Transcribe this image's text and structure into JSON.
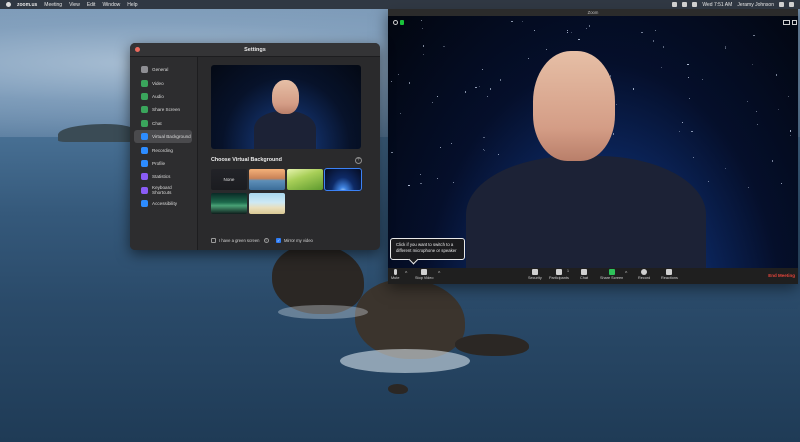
{
  "menubar": {
    "app_name": "zoom.us",
    "menus": [
      "Meeting",
      "View",
      "Edit",
      "Window",
      "Help"
    ],
    "clock": "Wed 7:51 AM",
    "user": "Jeramy Johnson"
  },
  "settings": {
    "title": "Settings",
    "sidebar": [
      {
        "label": "General",
        "icon": "gear-icon",
        "color": "#8e8e93"
      },
      {
        "label": "Video",
        "icon": "video-camera-icon",
        "color": "#3aa55c"
      },
      {
        "label": "Audio",
        "icon": "headphones-icon",
        "color": "#3aa55c"
      },
      {
        "label": "Share Screen",
        "icon": "share-screen-icon",
        "color": "#3aa55c"
      },
      {
        "label": "Chat",
        "icon": "chat-icon",
        "color": "#3aa55c"
      },
      {
        "label": "Virtual Background",
        "icon": "virtual-background-icon",
        "color": "#2d8cff",
        "active": true
      },
      {
        "label": "Recording",
        "icon": "recording-icon",
        "color": "#2d8cff"
      },
      {
        "label": "Profile",
        "icon": "profile-icon",
        "color": "#2d8cff"
      },
      {
        "label": "Statistics",
        "icon": "statistics-icon",
        "color": "#8a5cf6"
      },
      {
        "label": "Keyboard Shortcuts",
        "icon": "keyboard-icon",
        "color": "#8a5cf6"
      },
      {
        "label": "Accessibility",
        "icon": "accessibility-icon",
        "color": "#2d8cff"
      }
    ],
    "choose_label": "Choose Virtual Background",
    "add_symbol": "+",
    "backgrounds": [
      {
        "label": "None"
      },
      {
        "label": ""
      },
      {
        "label": ""
      },
      {
        "label": "",
        "selected": true
      },
      {
        "label": ""
      },
      {
        "label": ""
      }
    ],
    "green_screen_label": "I have a green screen",
    "mirror_label": "Mirror my video",
    "green_screen_checked": false,
    "mirror_checked": true
  },
  "zoom": {
    "title": "Zoom",
    "toolbar": [
      {
        "label": "Mute",
        "icon": "microphone-icon"
      },
      {
        "label": "Stop Video",
        "icon": "video-camera-icon"
      },
      {
        "label": "Security",
        "icon": "security-shield-icon"
      },
      {
        "label": "Participants",
        "icon": "participants-icon",
        "badge": "1"
      },
      {
        "label": "Chat",
        "icon": "chat-icon"
      },
      {
        "label": "Share Screen",
        "icon": "share-screen-icon"
      },
      {
        "label": "Record",
        "icon": "record-icon"
      },
      {
        "label": "Reactions",
        "icon": "reactions-icon"
      }
    ],
    "end_label": "End Meeting",
    "tooltip": "Click if you want to switch to a different microphone or speaker"
  }
}
